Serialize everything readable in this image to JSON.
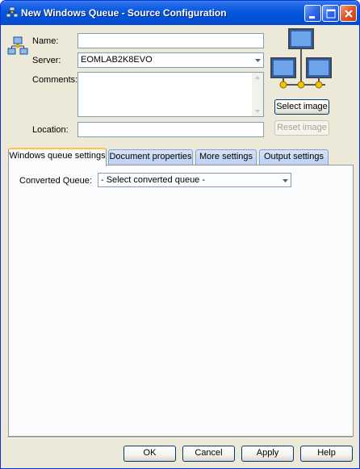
{
  "window": {
    "title": "New Windows Queue - Source Configuration"
  },
  "form": {
    "name_label": "Name:",
    "name_value": "",
    "server_label": "Server:",
    "server_value": "EOMLAB2K8EVO",
    "comments_label": "Comments:",
    "comments_value": "",
    "location_label": "Location:",
    "location_value": ""
  },
  "image_panel": {
    "select_label": "Select image",
    "reset_label": "Reset image"
  },
  "tabs": [
    {
      "label": "Windows queue settings",
      "active": true
    },
    {
      "label": "Document properties",
      "active": false
    },
    {
      "label": "More settings",
      "active": false
    },
    {
      "label": "Output settings",
      "active": false
    }
  ],
  "queue_settings": {
    "converted_queue_label": "Converted Queue:",
    "converted_queue_value": "- Select converted queue -"
  },
  "footer": {
    "ok_label": "OK",
    "cancel_label": "Cancel",
    "apply_label": "Apply",
    "help_label": "Help"
  },
  "colors": {
    "titlebar": "#0052d6",
    "dialog_bg": "#ece9d8",
    "field_border": "#7f9db9",
    "tab_highlight": "#ffc83c"
  }
}
